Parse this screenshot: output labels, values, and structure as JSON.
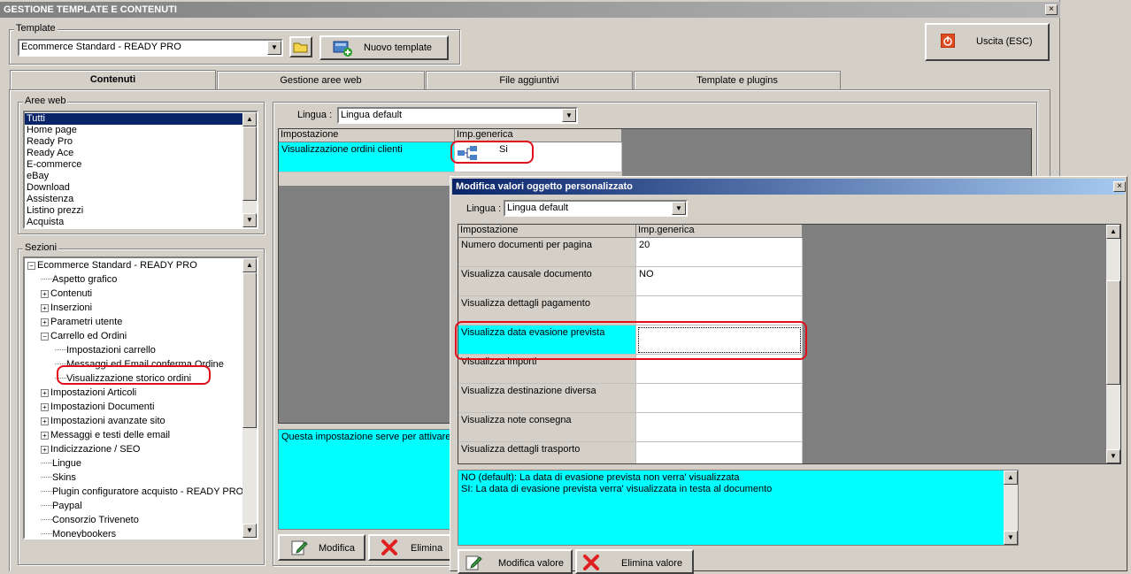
{
  "main_window": {
    "title": "GESTIONE TEMPLATE E CONTENUTI",
    "template_group_label": "Template",
    "template_value": "Ecommerce Standard - READY PRO",
    "new_template_label": "Nuovo template",
    "exit_label": "Uscita (ESC)"
  },
  "tabs": [
    {
      "label": "Contenuti"
    },
    {
      "label": "Gestione aree web"
    },
    {
      "label": "File aggiuntivi"
    },
    {
      "label": "Template e plugins"
    }
  ],
  "aree_web": {
    "label": "Aree web",
    "items": [
      "Tutti",
      "Home page",
      "Ready Pro",
      "Ready Ace",
      "E-commerce",
      "eBay",
      "Download",
      "Assistenza",
      "Listino prezzi",
      "Acquista"
    ]
  },
  "sezioni": {
    "label": "Sezioni",
    "root": "Ecommerce Standard - READY PRO",
    "items": [
      {
        "label": "Aspetto grafico"
      },
      {
        "label": "Contenuti"
      },
      {
        "label": "Inserzioni"
      },
      {
        "label": "Parametri utente"
      },
      {
        "label": "Carrello ed Ordini"
      },
      {
        "label": "Impostazioni carrello"
      },
      {
        "label": "Messaggi ed Email conferma Ordine"
      },
      {
        "label": "Visualizzazione storico ordini"
      },
      {
        "label": "Impostazioni Articoli"
      },
      {
        "label": "Impostazioni Documenti"
      },
      {
        "label": "Impostazioni avanzate sito"
      },
      {
        "label": "Messaggi e testi delle email"
      },
      {
        "label": "Indicizzazione / SEO"
      },
      {
        "label": "Lingue"
      },
      {
        "label": "Skins"
      },
      {
        "label": "Plugin configuratore acquisto - READY PRO"
      },
      {
        "label": "Paypal"
      },
      {
        "label": "Consorzio Triveneto"
      },
      {
        "label": "Moneybookers"
      }
    ]
  },
  "right_panel": {
    "lingua_label": "Lingua :",
    "lingua_value": "Lingua default",
    "col_impostazione": "Impostazione",
    "col_imp_generica": "Imp.generica",
    "row_label": "Visualizzazione ordini clienti",
    "row_value": "Si",
    "description": "Questa impostazione serve per attivare",
    "modifica_label": "Modifica",
    "elimina_label": "Elimina"
  },
  "dialog": {
    "title": "Modifica valori oggetto personalizzato",
    "lingua_label": "Lingua :",
    "lingua_value": "Lingua default",
    "col_impostazione": "Impostazione",
    "col_imp_generica": "Imp.generica",
    "rows": [
      {
        "label": "Numero documenti per pagina",
        "value": "20"
      },
      {
        "label": "Visualizza causale documento",
        "value": "NO"
      },
      {
        "label": "Visualizza dettagli pagamento",
        "value": ""
      },
      {
        "label": "Visualizza data evasione prevista",
        "value": ""
      },
      {
        "label": "Visualizza importi",
        "value": ""
      },
      {
        "label": "Visualizza destinazione diversa",
        "value": ""
      },
      {
        "label": "Visualizza note consegna",
        "value": ""
      },
      {
        "label": "Visualizza dettagli trasporto",
        "value": ""
      }
    ],
    "description_line1": "NO (default): La data di evasione prevista non verra' visualizzata",
    "description_line2": "SI: La data di evasione prevista verra' visualizzata in testa al documento",
    "modifica_valore_label": "Modifica valore",
    "elimina_valore_label": "Elimina valore"
  }
}
